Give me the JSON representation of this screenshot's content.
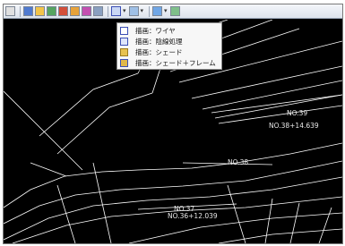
{
  "toolbar": {
    "icons": [
      "cursor-icon",
      "open-icon",
      "grid-icon",
      "layers-icon",
      "render-mode-icon",
      "coordinate-icon",
      "color-icon",
      "tool-icon",
      "draw-mode-icon",
      "view-icon",
      "arrow-icon",
      "pen-icon"
    ]
  },
  "menu": {
    "items": [
      {
        "label": "描画：ワイヤ",
        "icon": "wire-icon"
      },
      {
        "label": "描画：陰線処理",
        "icon": "hidden-line-icon"
      },
      {
        "label": "描画：シェード",
        "icon": "shade-icon"
      },
      {
        "label": "描画：シェード＋フレーム",
        "icon": "shade-frame-icon"
      }
    ]
  },
  "labels": {
    "no39": "NO.39",
    "no38_14": "NO.38+14.639",
    "no38": "NO.38",
    "no37": "NO.37",
    "no36_12": "NO.36+12.039"
  },
  "colors": {
    "background": "#000000",
    "lines": "#ffffff",
    "menu_bg": "#f7f7f7"
  }
}
